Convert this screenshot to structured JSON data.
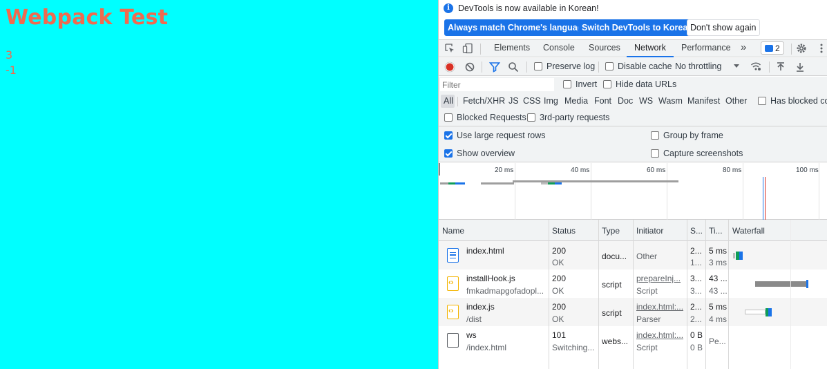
{
  "page": {
    "title": "Webpack Test",
    "lines": [
      "3",
      "-1"
    ]
  },
  "devtools": {
    "infobar": {
      "message": "DevTools is now available in Korean!",
      "buttons": [
        "Always match Chrome's language",
        "Switch DevTools to Korean",
        "Don't show again"
      ]
    },
    "tabs": [
      "Elements",
      "Console",
      "Sources",
      "Network",
      "Performance"
    ],
    "active_tab": "Network",
    "more_tabs": "»",
    "issues_count": "2",
    "toolbar": {
      "preserve_log": "Preserve log",
      "disable_cache": "Disable cache",
      "throttling": "No throttling"
    },
    "filter": {
      "placeholder": "Filter",
      "invert": "Invert",
      "hide_data_urls": "Hide data URLs"
    },
    "type_filters": [
      "All",
      "Fetch/XHR",
      "JS",
      "CSS",
      "Img",
      "Media",
      "Font",
      "Doc",
      "WS",
      "Wasm",
      "Manifest",
      "Other"
    ],
    "has_blocked_cookies": "Has blocked coo",
    "blocked_requests": "Blocked Requests",
    "third_party": "3rd-party requests",
    "settings": {
      "use_large_rows": "Use large request rows",
      "show_overview": "Show overview",
      "group_by_frame": "Group by frame",
      "capture_screenshots": "Capture screenshots"
    },
    "overview_ticks": [
      "20 ms",
      "40 ms",
      "60 ms",
      "80 ms",
      "100 ms"
    ],
    "columns": [
      "Name",
      "Status",
      "Type",
      "Initiator",
      "S...",
      "Ti...",
      "Waterfall"
    ],
    "rows": [
      {
        "icon": "document-icon",
        "name": "index.html",
        "path": "",
        "status": "200",
        "status_text": "OK",
        "type": "docu...",
        "initiator": "Other",
        "initiator_sub": "",
        "size": "2...",
        "size_sub": "1...",
        "time": "5 ms",
        "time_sub": "3 ms"
      },
      {
        "icon": "script-icon",
        "name": "installHook.js",
        "path": "fmkadmapgofadopl...",
        "status": "200",
        "status_text": "OK",
        "type": "script",
        "initiator": "prepareInj...",
        "initiator_sub": "Script",
        "size": "3...",
        "size_sub": "3...",
        "time": "43 ...",
        "time_sub": "43 ..."
      },
      {
        "icon": "script-icon",
        "name": "index.js",
        "path": "/dist",
        "status": "200",
        "status_text": "OK",
        "type": "script",
        "initiator": "index.html:...",
        "initiator_sub": "Parser",
        "size": "2...",
        "size_sub": "2...",
        "time": "5 ms",
        "time_sub": "4 ms"
      },
      {
        "icon": "file-icon",
        "name": "ws",
        "path": "/index.html",
        "status": "101",
        "status_text": "Switching...",
        "type": "webs...",
        "initiator": "index.html:...",
        "initiator_sub": "Script",
        "size": "0 B",
        "size_sub": "0 B",
        "time": "Pe...",
        "time_sub": ""
      }
    ],
    "colors": {
      "accent": "#1a73e8",
      "record": "#d93025",
      "page_bg": "#00ffff",
      "page_text": "#f06a4f"
    }
  }
}
